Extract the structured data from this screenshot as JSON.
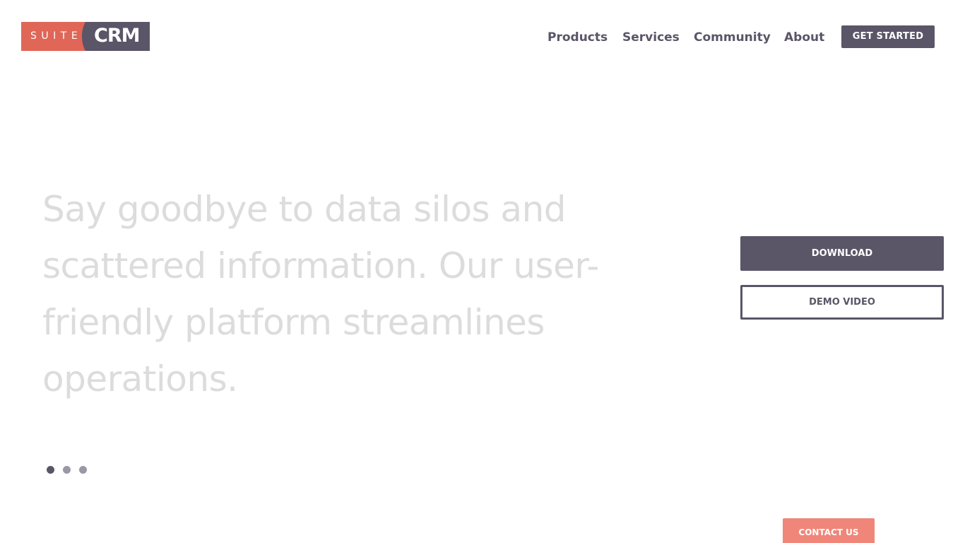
{
  "logo": {
    "left_text": "SUITE",
    "right_text": "CRM"
  },
  "nav": {
    "items": [
      {
        "label": "Products"
      },
      {
        "label": "Services"
      },
      {
        "label": "Community"
      },
      {
        "label": "About"
      }
    ],
    "cta_label": "GET STARTED"
  },
  "hero": {
    "headline": "Say goodbye to data silos and scattered information. Our user-friendly platform streamlines operations.",
    "download_label": "DOWNLOAD",
    "demo_label": "DEMO VIDEO"
  },
  "carousel": {
    "slide_count": 3,
    "active_slide": 1
  },
  "contact": {
    "label": "CONTACT US"
  },
  "colors": {
    "brand_dark": "#5a5567",
    "brand_accent": "#e06658",
    "contact_bg": "#ef8679",
    "hero_text": "#dcdcdc"
  }
}
